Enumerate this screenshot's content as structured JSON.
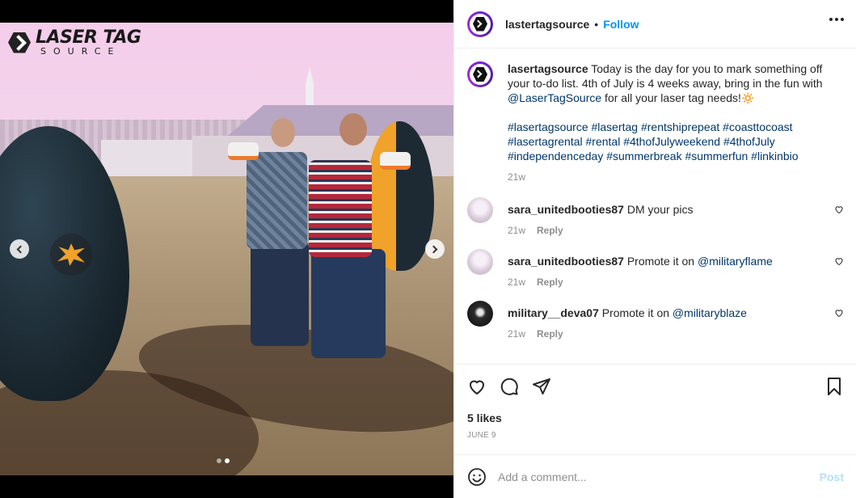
{
  "brand": {
    "line1": "LASER TAG",
    "line2": "SOURCE"
  },
  "header": {
    "username": "lastertagsource",
    "separator": "•",
    "follow_label": "Follow",
    "more_icon": "more-horizontal-icon"
  },
  "caption": {
    "username": "lasertagsource",
    "text_before": " Today is the day for you to mark something off your to-do list. 4th of July is 4 weeks away, bring in the fun with ",
    "mention": "@LaserTagSource",
    "text_after": " for all your laser tag needs!🔅",
    "hashtags": "#lasertagsource #lasertag #rentshiprepeat #coasttocoast #lasertagrental #rental #4thofJulyweekend #4thofJuly #independenceday #summerbreak #summerfun #linkinbio",
    "time": "21w"
  },
  "comments": [
    {
      "username": "sara_unitedbooties87",
      "text": " DM your pics",
      "mention": "",
      "time": "21w",
      "reply": "Reply"
    },
    {
      "username": "sara_unitedbooties87",
      "text": " Promote it on ",
      "mention": "@militaryflame",
      "time": "21w",
      "reply": "Reply"
    },
    {
      "username": "military__deva07",
      "text": " Promote it on ",
      "mention": "@militaryblaze",
      "time": "21w",
      "reply": "Reply"
    }
  ],
  "actions": {
    "likes": "5 likes",
    "date": "JUNE 9"
  },
  "add_comment": {
    "placeholder": "Add a comment...",
    "post_label": "Post"
  },
  "colors": {
    "link": "#0095f6",
    "mention": "#00376b",
    "muted": "#8e8e8e",
    "post_disabled": "#b2dffc"
  }
}
